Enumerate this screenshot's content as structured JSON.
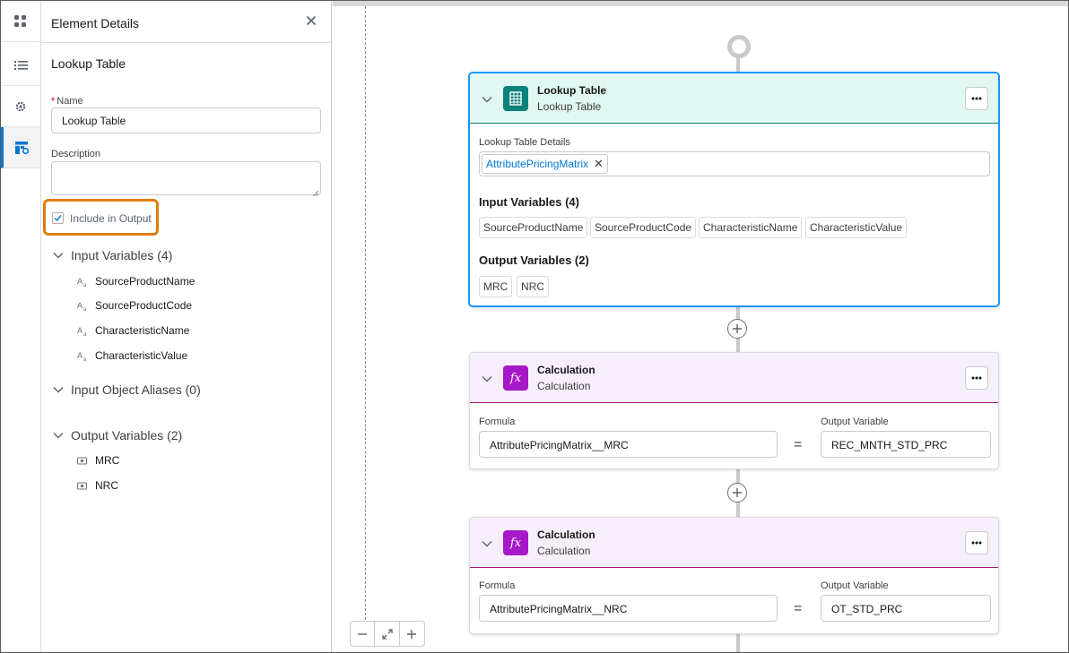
{
  "rail": {
    "items": [
      {
        "icon": "apps-grid-icon"
      },
      {
        "icon": "list-icon"
      },
      {
        "icon": "gear-icon"
      },
      {
        "icon": "layout-settings-icon",
        "active": true
      }
    ]
  },
  "panel": {
    "title": "Element Details",
    "element_type": "Lookup Table",
    "name_label": "Name",
    "name_required_marker": "*",
    "name_value": "Lookup Table",
    "description_label": "Description",
    "description_value": "",
    "include_output_label": "Include in Output",
    "include_output_checked": true,
    "input_variables": {
      "title": "Input Variables (4)",
      "items": [
        "SourceProductName",
        "SourceProductCode",
        "CharacteristicName",
        "CharacteristicValue"
      ]
    },
    "input_object_aliases": {
      "title": "Input Object Aliases (0)"
    },
    "output_variables": {
      "title": "Output Variables (2)",
      "items": [
        "MRC",
        "NRC"
      ]
    }
  },
  "canvas": {
    "lookup_card": {
      "title": "Lookup Table",
      "subtitle": "Lookup Table",
      "details_label": "Lookup Table Details",
      "selected_table": "AttributePricingMatrix",
      "input_title": "Input Variables (4)",
      "inputs": [
        "SourceProductName",
        "SourceProductCode",
        "CharacteristicName",
        "CharacteristicValue"
      ],
      "output_title": "Output Variables (2)",
      "outputs": [
        "MRC",
        "NRC"
      ],
      "accent_color": "#0b827c"
    },
    "calc_cards": [
      {
        "title": "Calculation",
        "subtitle": "Calculation",
        "icon_text": "fx",
        "formula_label": "Formula",
        "formula": "AttributePricingMatrix__MRC",
        "equals": "=",
        "output_label": "Output Variable",
        "output": "REC_MNTH_STD_PRC"
      },
      {
        "title": "Calculation",
        "subtitle": "Calculation",
        "icon_text": "fx",
        "formula_label": "Formula",
        "formula": "AttributePricingMatrix__NRC",
        "equals": "=",
        "output_label": "Output Variable",
        "output": "OT_STD_PRC"
      }
    ],
    "calc_accent_color": "#a718c8",
    "highlight_color": "#e07d10"
  }
}
